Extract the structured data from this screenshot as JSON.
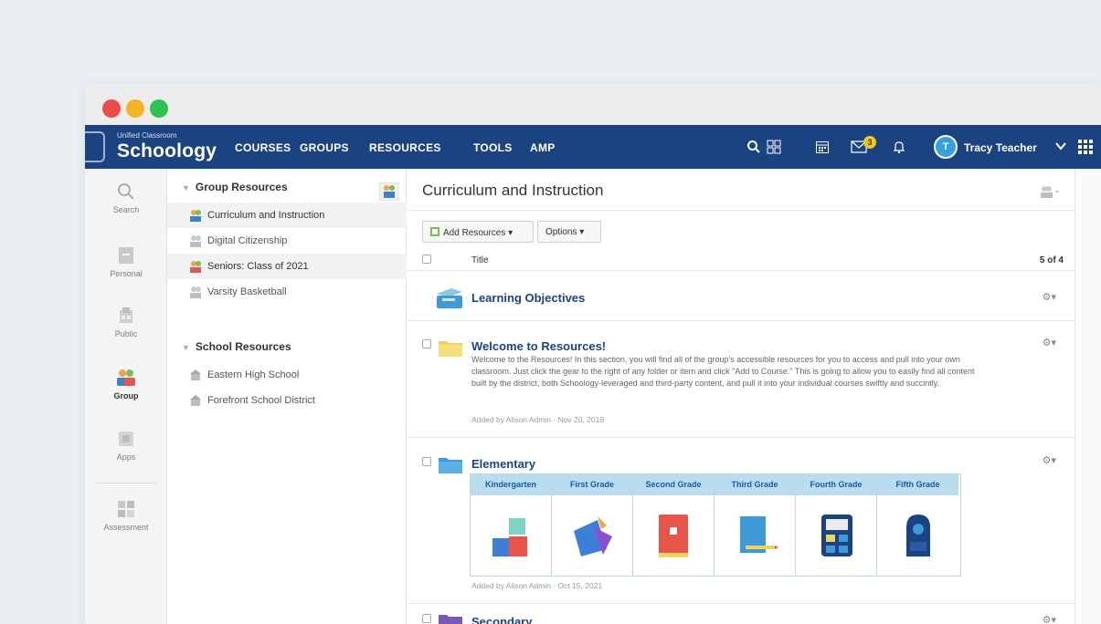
{
  "window": {
    "controls": [
      "close",
      "minimize",
      "zoom"
    ]
  },
  "topnav": {
    "logo_sub": "Unified Classroom",
    "logo_main": "Schoology",
    "links": [
      "COURSES",
      "GROUPS",
      "RESOURCES",
      "TOOLS",
      "AMP"
    ],
    "notification_count": "3",
    "user_initial": "T",
    "user_name": "Tracy Teacher",
    "colors": {
      "nav_bg": "#1b4381",
      "badge": "#f5c518",
      "avatar": "#38a0e0"
    }
  },
  "leftrail": {
    "items": [
      {
        "label": "Search",
        "icon": "search-icon"
      },
      {
        "label": "Personal",
        "icon": "personal-icon"
      },
      {
        "label": "Public",
        "icon": "public-icon"
      },
      {
        "label": "Group",
        "icon": "group-icon",
        "active": true
      },
      {
        "label": "Apps",
        "icon": "apps-icon"
      },
      {
        "label": "Assessment",
        "icon": "assessment-icon"
      }
    ]
  },
  "tree": {
    "group_heading": "Group Resources",
    "group_items": [
      {
        "label": "Curriculum and Instruction",
        "active": true
      },
      {
        "label": "Digital Citizenship"
      },
      {
        "label": "Seniors: Class of 2021"
      },
      {
        "label": "Varsity Basketball"
      }
    ],
    "school_heading": "School Resources",
    "school_items": [
      {
        "label": "Eastern High School"
      },
      {
        "label": "Forefront School District"
      }
    ]
  },
  "main": {
    "title": "Curriculum and Instruction",
    "add_resources": "Add Resources",
    "options": "Options",
    "col_title": "Title",
    "count": "5 of 4",
    "items": [
      {
        "title": "Learning Objectives"
      },
      {
        "title": "Welcome to Resources!",
        "description": "Welcome to the Resources! In this section, you will find all of the group's accessible resources for you to access and pull into your own classroom. Just click the gear to the right of any folder or item and click \"Add to Course.\" This is going to allow you to easily find all content built by the district, both Schoology-leveraged and third-party content, and pull it into your individual courses swiftly and succintly.",
        "meta": "Added by Alison Admin · Nov 20, 2019"
      },
      {
        "title": "Elementary",
        "grades": [
          "Kindergarten",
          "First Grade",
          "Second Grade",
          "Third Grade",
          "Fourth Grade",
          "Fifth Grade"
        ],
        "meta": "Added by Alison Admin · Oct 15, 2021"
      },
      {
        "title": "Secondary"
      }
    ]
  }
}
